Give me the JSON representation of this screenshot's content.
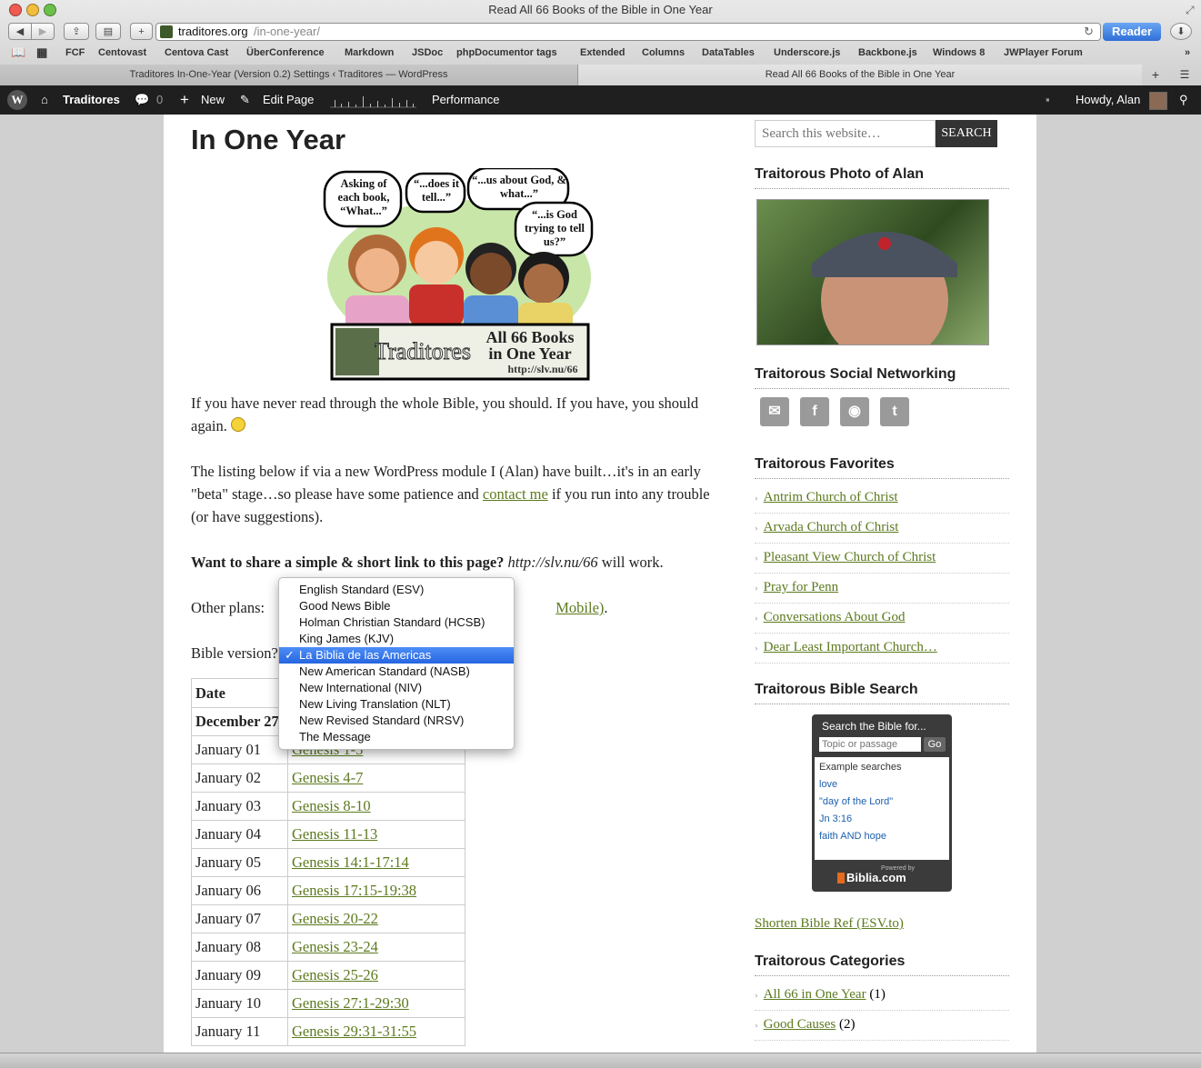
{
  "window": {
    "title": "Read All 66 Books of the Bible in One Year"
  },
  "toolbar": {
    "url_domain": "traditores.org",
    "url_path": "/in-one-year/",
    "reader_label": "Reader"
  },
  "bookmarks": [
    "FCF",
    "Centovast",
    "Centova Cast",
    "ÜberConference",
    "Markdown",
    "JSDoc",
    "phpDocumentor tags",
    "Extended",
    "Columns",
    "DataTables",
    "Underscore.js",
    "Backbone.js",
    "Windows 8",
    "JWPlayer Forum"
  ],
  "tabs": [
    {
      "label": "Traditores In-One-Year (Version 0.2) Settings ‹ Traditores — WordPress"
    },
    {
      "label": "Read All 66 Books of the Bible in One Year"
    }
  ],
  "adminbar": {
    "site_name": "Traditores",
    "comments_count": "0",
    "new_label": "New",
    "edit_label": "Edit Page",
    "performance_label": "Performance",
    "howdy_label": "Howdy, Alan"
  },
  "page": {
    "title": "In One Year",
    "hero_texts": {
      "bubble1": "Asking of each book, “What...”",
      "bubble2": "“...does it tell...”",
      "bubble3": "“...us about God, & what...”",
      "bubble4": "“...is God trying to tell us?”",
      "logo_word": "Traditores",
      "book_line1": "All 66 Books",
      "book_line2": "in One Year",
      "url": "http://slv.nu/66"
    },
    "p1": "If you have never read through the whole Bible, you should. If you have, you should again.",
    "p2_before": "The listing below if via a new WordPress module I (Alan) have built…it's in an early \"beta\" stage…so please have some patience and",
    "p2_link": "contact me",
    "p2_after": "if you run into any trouble (or have suggestions).",
    "p3_bold": "Want to share a simple & short link to this page?",
    "p3_italic": "http://slv.nu/66",
    "p3_after": "will work.",
    "other_plans_label": "Other plans:",
    "other_plans_link_tail": "Mobile)",
    "bible_version_label": "Bible version?"
  },
  "dropdown": {
    "options": [
      "English Standard (ESV)",
      "Good News Bible",
      "Holman Christian Standard (HCSB)",
      "King James (KJV)",
      "La Biblia de las Americas",
      "New American Standard (NASB)",
      "New International (NIV)",
      "New Living Translation (NLT)",
      "New Revised Standard (NRSV)",
      "The Message"
    ],
    "selected_index": 4
  },
  "table": {
    "header_date": "Date",
    "row0_date": "December 27",
    "rows": [
      {
        "date": "January 01",
        "reading": "Genesis 1-3"
      },
      {
        "date": "January 02",
        "reading": "Genesis 4-7"
      },
      {
        "date": "January 03",
        "reading": "Genesis 8-10"
      },
      {
        "date": "January 04",
        "reading": "Genesis 11-13"
      },
      {
        "date": "January 05",
        "reading": "Genesis 14:1-17:14"
      },
      {
        "date": "January 06",
        "reading": "Genesis 17:15-19:38"
      },
      {
        "date": "January 07",
        "reading": "Genesis 20-22"
      },
      {
        "date": "January 08",
        "reading": "Genesis 23-24"
      },
      {
        "date": "January 09",
        "reading": "Genesis 25-26"
      },
      {
        "date": "January 10",
        "reading": "Genesis 27:1-29:30"
      },
      {
        "date": "January 11",
        "reading": "Genesis 29:31-31:55"
      }
    ]
  },
  "sidebar": {
    "search_placeholder": "Search this website…",
    "search_button": "SEARCH",
    "photo_title": "Traitorous Photo of Alan",
    "social_title": "Traitorous Social Networking",
    "favorites_title": "Traitorous Favorites",
    "favorites": [
      "Antrim Church of Christ",
      "Arvada Church of Christ",
      "Pleasant View Church of Christ",
      "Pray for Penn",
      "Conversations About God",
      "Dear Least Important Church…"
    ],
    "bible_search_title": "Traitorous Bible Search",
    "biblia": {
      "heading": "Search the Bible for...",
      "placeholder": "Topic or passage",
      "go": "Go",
      "examples_label": "Example searches",
      "examples": [
        "love",
        "\"day of the Lord\"",
        "Jn 3:16",
        "faith AND hope"
      ],
      "powered_by": "Powered by",
      "brand": "Biblia.com"
    },
    "shorten_link": "Shorten Bible Ref (ESV.to)",
    "categories_title": "Traitorous Categories",
    "categories": [
      {
        "name": "All 66 in One Year",
        "count": "(1)"
      },
      {
        "name": "Good Causes",
        "count": "(2)"
      }
    ]
  }
}
